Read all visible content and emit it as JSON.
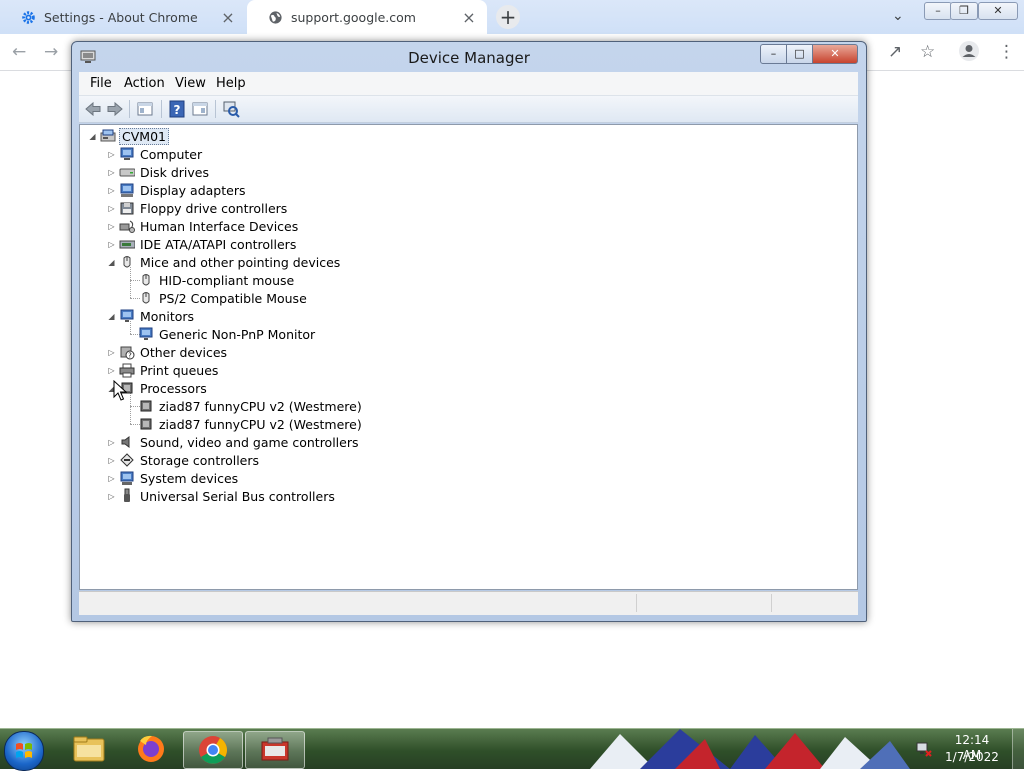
{
  "browser": {
    "tabs": [
      {
        "title": "Settings - About Chrome",
        "icon": "gear-icon"
      },
      {
        "title": "support.google.com",
        "icon": "globe-icon"
      }
    ],
    "new_tab": "+",
    "close_glyph": "×"
  },
  "device_manager": {
    "title": "Device Manager",
    "menu": [
      "File",
      "Action",
      "View",
      "Help"
    ],
    "tree": {
      "root": "CVM01",
      "categories": [
        {
          "label": "Computer",
          "expanded": false,
          "icon": "computer-icon"
        },
        {
          "label": "Disk drives",
          "expanded": false,
          "icon": "disk-drive-icon"
        },
        {
          "label": "Display adapters",
          "expanded": false,
          "icon": "display-adapter-icon"
        },
        {
          "label": "Floppy drive controllers",
          "expanded": false,
          "icon": "floppy-controller-icon"
        },
        {
          "label": "Human Interface Devices",
          "expanded": false,
          "icon": "hid-icon"
        },
        {
          "label": "IDE ATA/ATAPI controllers",
          "expanded": false,
          "icon": "ide-controller-icon"
        },
        {
          "label": "Mice and other pointing devices",
          "expanded": true,
          "icon": "mouse-icon",
          "children": [
            "HID-compliant mouse",
            "PS/2 Compatible Mouse"
          ]
        },
        {
          "label": "Monitors",
          "expanded": true,
          "icon": "monitor-icon",
          "children": [
            "Generic Non-PnP Monitor"
          ]
        },
        {
          "label": "Other devices",
          "expanded": false,
          "icon": "unknown-device-icon"
        },
        {
          "label": "Print queues",
          "expanded": false,
          "icon": "printer-icon"
        },
        {
          "label": "Processors",
          "expanded": true,
          "icon": "processor-icon",
          "children": [
            "ziad87 funnyCPU v2 (Westmere)",
            "ziad87 funnyCPU v2 (Westmere)"
          ]
        },
        {
          "label": "Sound, video and game controllers",
          "expanded": false,
          "icon": "speaker-icon"
        },
        {
          "label": "Storage controllers",
          "expanded": false,
          "icon": "storage-controller-icon"
        },
        {
          "label": "System devices",
          "expanded": false,
          "icon": "system-device-icon"
        },
        {
          "label": "Universal Serial Bus controllers",
          "expanded": false,
          "icon": "usb-icon"
        }
      ]
    }
  },
  "taskbar": {
    "apps": [
      "file-explorer-icon",
      "firefox-icon",
      "chrome-icon",
      "device-manager-icon"
    ],
    "time": "12:14 AM",
    "date": "1/7/2022"
  }
}
